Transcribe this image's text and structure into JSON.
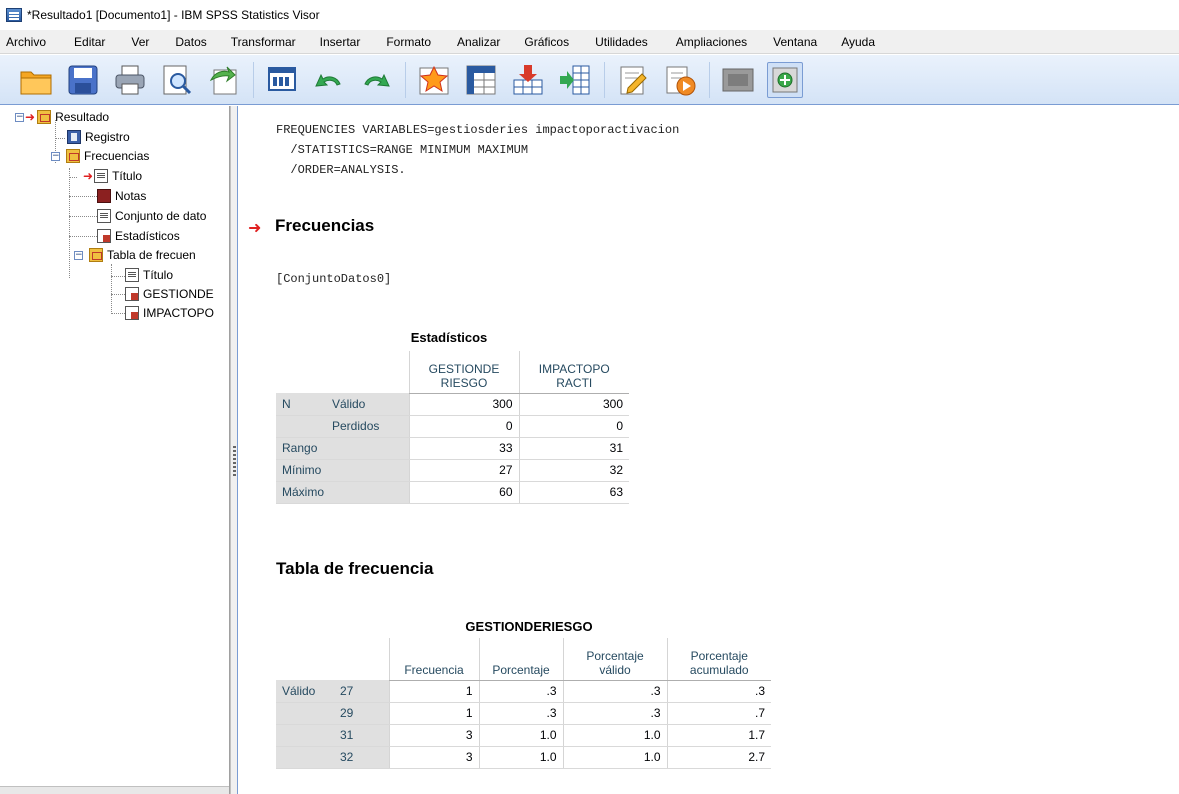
{
  "window": {
    "title": "*Resultado1 [Documento1] - IBM SPSS Statistics Visor"
  },
  "menu": [
    "Archivo",
    "Editar",
    "Ver",
    "Datos",
    "Transformar",
    "Insertar",
    "Formato",
    "Analizar",
    "Gráficos",
    "Utilidades",
    "Ampliaciones",
    "Ventana",
    "Ayuda"
  ],
  "toolbar_icons": [
    "open-icon",
    "save-icon",
    "print-icon",
    "print-preview-icon",
    "export-icon",
    "recall-dialog-icon",
    "undo-icon",
    "redo-icon",
    "goto-data-icon",
    "goto-variable-icon",
    "insert-cases-icon",
    "insert-variable-icon",
    "designate-window-icon",
    "run-icon",
    "hide-icon",
    "show-icon"
  ],
  "tree": {
    "root": "Resultado",
    "registro": "Registro",
    "frecuencias": "Frecuencias",
    "titulo": "Título",
    "notas": "Notas",
    "conjunto": "Conjunto de dato",
    "estadisticos": "Estadísticos",
    "tabla": "Tabla de frecuen",
    "titulo2": "Título",
    "gestion": "GESTIONDE",
    "impacto": "IMPACTOPO"
  },
  "syntax": {
    "line1": "FREQUENCIES VARIABLES=gestiosderies impactoporactivacion",
    "line2": "  /STATISTICS=RANGE MINIMUM MAXIMUM",
    "line3": "  /ORDER=ANALYSIS."
  },
  "heading_frecuencias": "Frecuencias",
  "dataset_label": "[ConjuntoDatos0]",
  "stats_table": {
    "title": "Estadísticos",
    "col1": [
      "GESTIONDE",
      "RIESGO"
    ],
    "col2": [
      "IMPACTOPO",
      "RACTI"
    ],
    "rows": [
      {
        "g": "N",
        "label": "Válido",
        "v1": "300",
        "v2": "300"
      },
      {
        "g": "",
        "label": "Perdidos",
        "v1": "0",
        "v2": "0"
      },
      {
        "g": "Rango",
        "label": "",
        "v1": "33",
        "v2": "31"
      },
      {
        "g": "Mínimo",
        "label": "",
        "v1": "27",
        "v2": "32"
      },
      {
        "g": "Máximo",
        "label": "",
        "v1": "60",
        "v2": "63"
      }
    ]
  },
  "heading_tabla": "Tabla de frecuencia",
  "freq_table": {
    "title": "GESTIONDERIESGO",
    "headers": [
      "Frecuencia",
      "Porcentaje",
      "Porcentaje válido",
      "Porcentaje acumulado"
    ],
    "h3": [
      "Porcentaje",
      "válido"
    ],
    "h4": [
      "Porcentaje",
      "acumulado"
    ],
    "group": "Válido",
    "rows": [
      {
        "val": "27",
        "f": "1",
        "p": ".3",
        "pv": ".3",
        "pa": ".3"
      },
      {
        "val": "29",
        "f": "1",
        "p": ".3",
        "pv": ".3",
        "pa": ".7"
      },
      {
        "val": "31",
        "f": "3",
        "p": "1.0",
        "pv": "1.0",
        "pa": "1.7"
      },
      {
        "val": "32",
        "f": "3",
        "p": "1.0",
        "pv": "1.0",
        "pa": "2.7"
      }
    ]
  }
}
